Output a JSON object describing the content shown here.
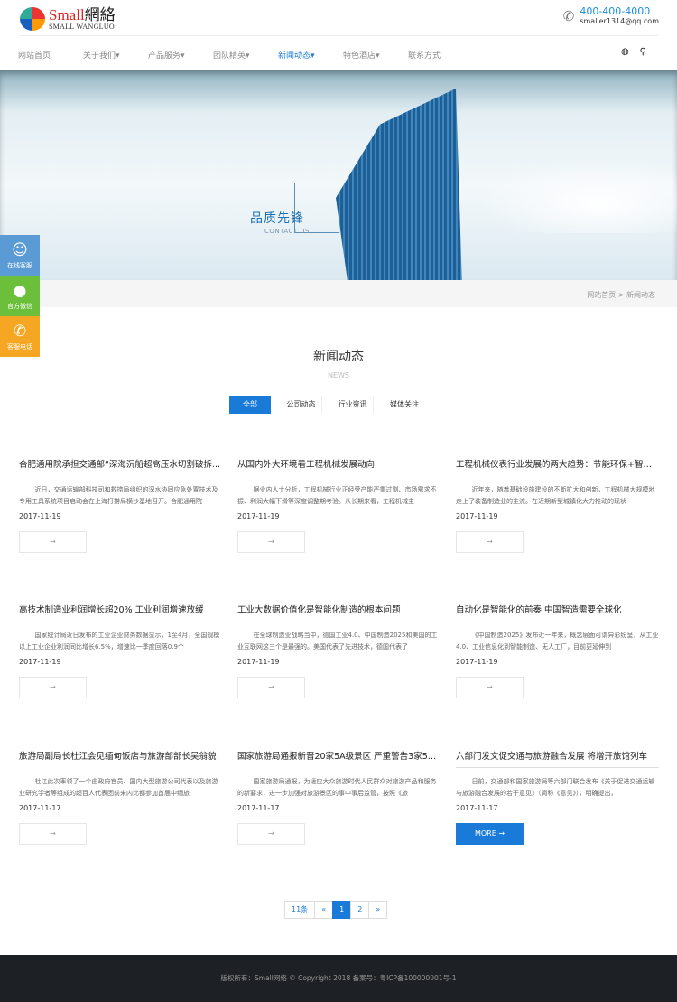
{
  "header": {
    "logo_main": "Small",
    "logo_cn": "網絡",
    "logo_sub": "SMALL WANGLUO",
    "phone": "400-400-4000",
    "email": "smaller1314@qq.com"
  },
  "nav": [
    {
      "label": "网站首页"
    },
    {
      "label": "关于我们▾"
    },
    {
      "label": "产品服务▾"
    },
    {
      "label": "团队精英▾"
    },
    {
      "label": "新闻动态▾"
    },
    {
      "label": "特色酒店▾"
    },
    {
      "label": "联系方式"
    }
  ],
  "banner": {
    "title": "品质先锋",
    "subtitle": "CONTACT US"
  },
  "breadcrumb": "网站首页 > 新闻动态",
  "side": [
    {
      "label": "在线客服",
      "color": "#5b9bd5"
    },
    {
      "label": "官方微信",
      "color": "#6cbf3a"
    },
    {
      "label": "客服电话",
      "color": "#f5a623"
    }
  ],
  "section": {
    "title": "新闻动态",
    "subtitle": "NEWS"
  },
  "tabs": [
    "全部",
    "公司动态",
    "行业资讯",
    "媒体关注"
  ],
  "news": [
    {
      "title": "合肥通用院承担交通部“深海沉船超高压水切割破拆...",
      "excerpt": "近日，交通运输部科技司和救捞局组织的深水协同应急处置技术及专用工具系统项目启动会在上海打捞局横沙基地召开。合肥通用院",
      "date": "2017-11-19",
      "more": "→"
    },
    {
      "title": "从国内外大环境看工程机械发展动向",
      "excerpt": "据业内人士分析，工程机械行业正经受产能严重过剩、市场需求不振、利润大幅下滑等深度调整期考验。从长期来看，工程机械主",
      "date": "2017-11-19",
      "more": "→"
    },
    {
      "title": "工程机械仪表行业发展的两大趋势：节能环保+智能...",
      "excerpt": "近年来，随着基础设施建设的不断扩大和创新，工程机械大规模地走上了装备制造业的主流。在近期新型城镇化大力推动的现状",
      "date": "2017-11-19",
      "more": "→"
    },
    {
      "title": "高技术制造业利润增长超20% 工业利润增速放缓",
      "excerpt": "国家统计局近日发布的工业企业财务数据显示，1至4月，全国规模以上工业企业利润同比增长6.5%，增速比一季度回落0.9个",
      "date": "2017-11-19",
      "more": "→"
    },
    {
      "title": "工业大数据价值化是智能化制造的根本问题",
      "excerpt": "在全球制造业战略当中，德国工业4.0、中国制造2025和美国的工业互联网这三个是最强的。美国代表了先进技术，德国代表了",
      "date": "2017-11-19",
      "more": "→"
    },
    {
      "title": "自动化是智能化的前奏 中国智造需要全球化",
      "excerpt": "《中国制造2025》发布近一年来，概念层面可谓异彩纷呈，从工业4.0、工业信息化到智能制造、无人工厂，目前更延伸到",
      "date": "2017-11-19",
      "more": "→"
    },
    {
      "title": "旅游局副局长杜江会见缅甸饭店与旅游部部长吴翁貌",
      "excerpt": "杜江此次率领了一个由政府官员、国内大型旅游公司代表以及旅游业研究学者等组成的超百人代表团前来内比都参加首届中缅旅",
      "date": "2017-11-17",
      "more": "→"
    },
    {
      "title": "国家旅游局通报新晋20家5A级景区 严重警告3家5A...",
      "excerpt": "国家旅游局通报，为适应大众旅游时代人民群众对旅游产品和服务的新要求，进一步加强对旅游景区的事中事后监管，按照《旅",
      "date": "2017-11-17",
      "more": "→"
    },
    {
      "title": "六部门发文促交通与旅游融合发展 将增开旅馆列车",
      "excerpt": "日前，交通部和国家旅游局等六部门联合发布《关于促进交通运输与旅游融合发展的若干意见》（简称《意见》），明确提出，",
      "date": "2017-11-17",
      "more": "MORE →"
    }
  ],
  "pagination": [
    "11条",
    "«",
    "1",
    "2",
    "»"
  ],
  "footer": "版权所有：Small网络 © Copyright 2018  备案号：粤ICP备100000001号-1"
}
